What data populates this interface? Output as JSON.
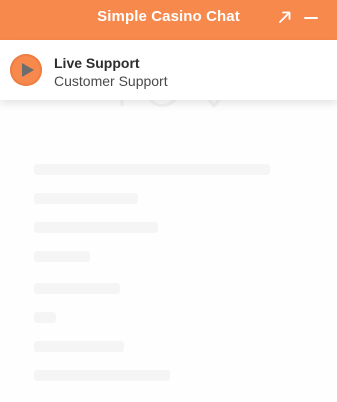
{
  "header": {
    "title": "Simple Casino Chat",
    "expand_icon": "expand-arrow-icon",
    "minimize_icon": "minimize-icon",
    "background_color": "#f7894d",
    "text_color": "#ffffff"
  },
  "agent": {
    "name": "Live Support",
    "role": "Customer Support",
    "avatar_icon": "play-icon",
    "avatar_color": "#f7894d"
  }
}
